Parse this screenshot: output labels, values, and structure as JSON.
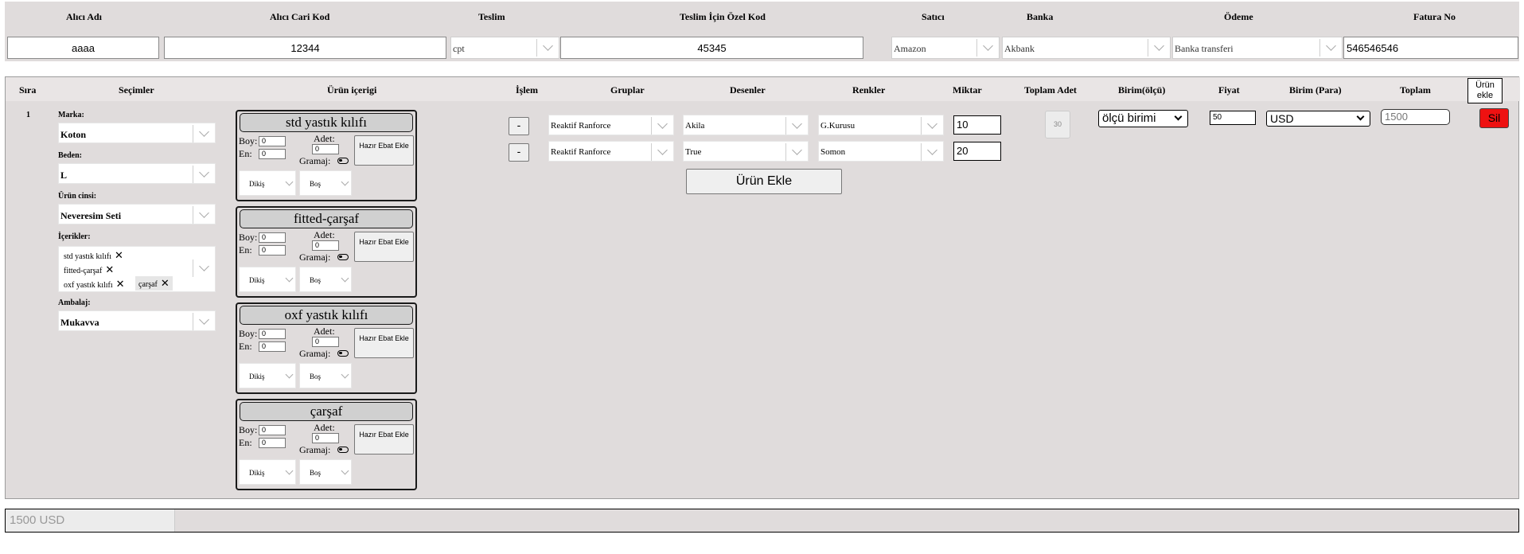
{
  "header": {
    "labels": [
      "Alıcı Adı",
      "Alıcı Cari Kod",
      "Teslim",
      "Teslim İçin Özel Kod",
      "Satıcı",
      "Banka",
      "Ödeme",
      "Fatura No"
    ],
    "alici_adi": "aaaa",
    "alici_cari_kod": "12344",
    "teslim": "cpt",
    "teslim_ozel_kod": "45345",
    "satici": "Amazon",
    "banka": "Akbank",
    "odeme": "Banka transferi",
    "fatura_no": "546546546"
  },
  "columns": {
    "sira": "Sıra",
    "secimler": "Seçimler",
    "urun_icerigi": "Ürün içerigi",
    "islem": "İşlem",
    "gruplar": "Gruplar",
    "desenler": "Desenler",
    "renkler": "Renkler",
    "miktar": "Miktar",
    "toplam_adet": "Toplam Adet",
    "birim_olcu": "Birim(ölçü)",
    "fiyat": "Fiyat",
    "birim_para": "Birim (Para)",
    "toplam": "Toplam",
    "urun_ekle": "Ürün ekle"
  },
  "row": {
    "sira": "1",
    "marka_label": "Marka:",
    "marka": "Koton",
    "beden_label": "Beden:",
    "beden": "L",
    "urun_cinsi_label": "Ürün cinsi:",
    "urun_cinsi": "Neveresim Seti",
    "icerikler_label": "İçerikler:",
    "icerikler": [
      "std yastık kılıfı",
      "fitted-çarşaf",
      "oxf yastık kılıfı",
      "çarşaf"
    ],
    "ambalaj_label": "Ambalaj:",
    "ambalaj": "Mukavva",
    "products": [
      {
        "title": "std yastık kılıfı",
        "boy": "0",
        "en": "0",
        "adet": "0"
      },
      {
        "title": "fitted-çarşaf",
        "boy": "0",
        "en": "0",
        "adet": "0"
      },
      {
        "title": "oxf yastık kılıfı",
        "boy": "0",
        "en": "0",
        "adet": "0"
      },
      {
        "title": "çarşaf",
        "boy": "0",
        "en": "0",
        "adet": "0"
      }
    ],
    "product_labels": {
      "boy": "Boy:",
      "en": "En:",
      "adet": "Adet:",
      "gramaj": "Gramaj:",
      "hazir": "Hazır Ebat Ekle",
      "dikis": "Dikiş",
      "bos": "Boş"
    },
    "lines": [
      {
        "islem": "-",
        "grup": "Reaktif Ranforce",
        "desen": "Akila",
        "renk": "G.Kurusu",
        "miktar": "10"
      },
      {
        "islem": "-",
        "grup": "Reaktif Ranforce",
        "desen": "True",
        "renk": "Somon",
        "miktar": "20"
      }
    ],
    "urun_ekle_button": "Ürün Ekle",
    "toplam_adet": "30",
    "birim_olcu": "ölçü birimi",
    "fiyat": "50",
    "birim_para": "USD",
    "toplam": "1500",
    "sil": "Sil"
  },
  "footer": {
    "total": "1500 USD"
  }
}
